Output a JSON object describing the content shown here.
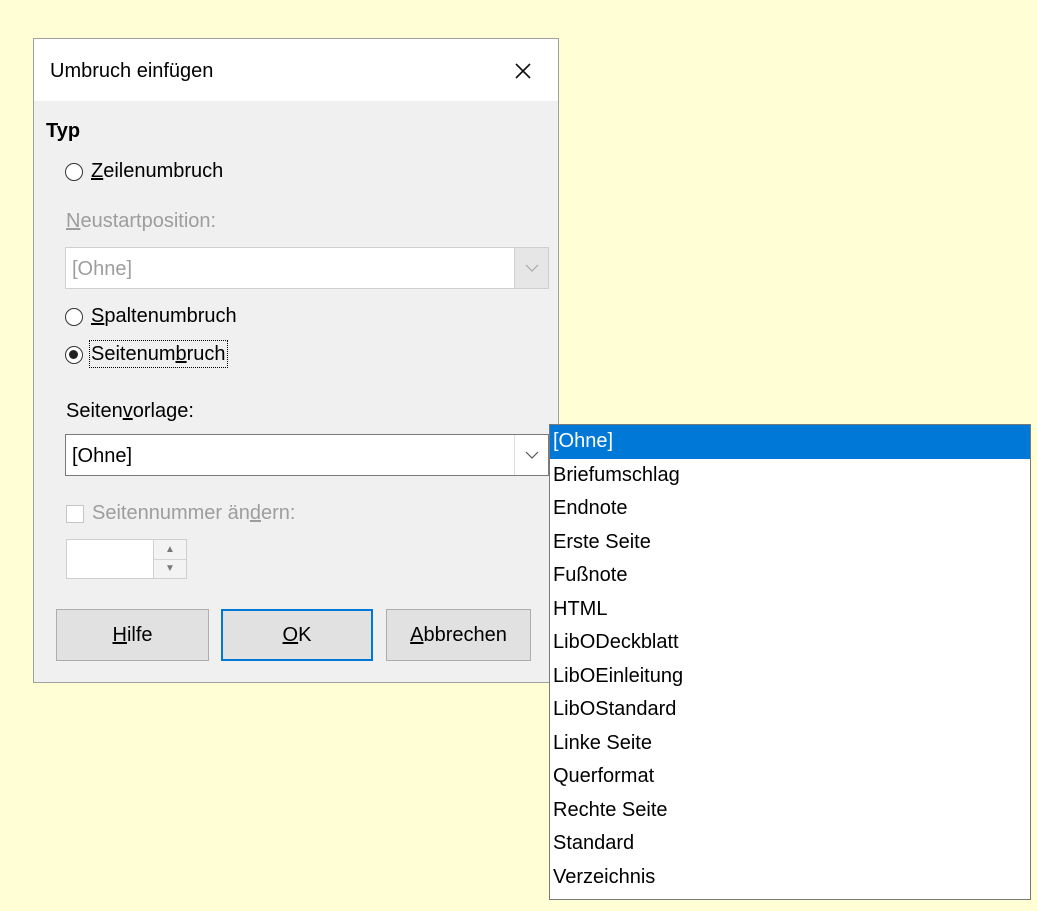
{
  "dialog": {
    "title": "Umbruch einfügen",
    "close_icon": "close-icon",
    "type_section": {
      "title": "Typ",
      "line_break": {
        "prefix": "",
        "mnemonic": "Z",
        "rest": "eilenumbruch",
        "checked": false
      },
      "restart_label": {
        "mnemonic": "N",
        "rest": "eustartposition:"
      },
      "restart_combo": {
        "value": "[Ohne]"
      },
      "column_break": {
        "mnemonic": "S",
        "rest": "paltenumbruch",
        "checked": false
      },
      "page_break": {
        "prefix": "Seitenum",
        "mnemonic": "b",
        "rest": "ruch",
        "checked": true
      }
    },
    "page_style": {
      "label_prefix": "Seiten",
      "label_mnemonic": "v",
      "label_rest": "orlage:",
      "value": "[Ohne]"
    },
    "change_page_number": {
      "label_prefix": "Seitennummer än",
      "label_mnemonic": "d",
      "label_rest": "ern:",
      "checked": false,
      "value": ""
    },
    "buttons": {
      "help": {
        "mnemonic": "H",
        "rest": "ilfe"
      },
      "ok": {
        "mnemonic": "O",
        "rest": "K"
      },
      "cancel": {
        "mnemonic": "A",
        "rest": "bbrechen"
      }
    }
  },
  "dropdown": {
    "selected_index": 0,
    "items": [
      "[Ohne]",
      "Briefumschlag",
      "Endnote",
      "Erste Seite",
      "Fußnote",
      "HTML",
      "LibODeckblatt",
      "LibOEinleitung",
      "LibOStandard",
      "Linke Seite",
      "Querformat",
      "Rechte Seite",
      "Standard",
      "Verzeichnis"
    ]
  },
  "colors": {
    "background": "#fffed5",
    "dialog": "#f0f0f0",
    "accent": "#0078d7",
    "disabled_text": "#9d9d9d"
  }
}
